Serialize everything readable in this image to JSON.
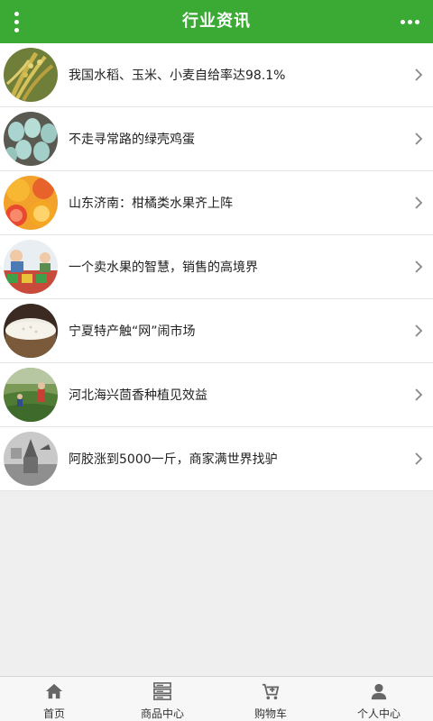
{
  "header": {
    "title": "行业资讯",
    "menu_icon": "vertical-dots-icon",
    "more_icon": "horizontal-dots-icon",
    "accent_color": "#3aaa35"
  },
  "news": [
    {
      "title": "我国水稻、玉米、小麦自给率达98.1%",
      "thumb": "rice-ear-photo"
    },
    {
      "title": "不走寻常路的绿壳鸡蛋",
      "thumb": "green-eggs-photo"
    },
    {
      "title": "山东济南：柑橘类水果齐上阵",
      "thumb": "citrus-photo"
    },
    {
      "title": "一个卖水果的智慧，销售的高境界",
      "thumb": "fruit-stall-photo"
    },
    {
      "title": "宁夏特产触“网”闹市场",
      "thumb": "rice-grain-photo"
    },
    {
      "title": "河北海兴茴香种植见效益",
      "thumb": "fennel-field-photo"
    },
    {
      "title": "阿胶涨到5000一斤，商家满世界找驴",
      "thumb": "donkey-photo"
    }
  ],
  "tabbar": [
    {
      "label": "首页",
      "icon": "home-icon"
    },
    {
      "label": "商品中心",
      "icon": "server-list-icon"
    },
    {
      "label": "购物车",
      "icon": "cart-icon"
    },
    {
      "label": "个人中心",
      "icon": "user-icon"
    }
  ]
}
